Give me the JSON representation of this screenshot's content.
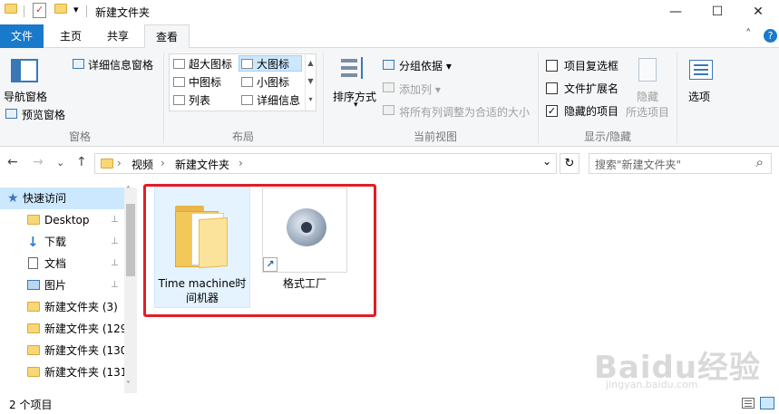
{
  "window": {
    "title": "新建文件夹",
    "quick_access_dropdown": "▾",
    "minimize": "—",
    "maximize": "☐",
    "close": "✕"
  },
  "ribbon_tabs": [
    "文件",
    "主页",
    "共享",
    "查看"
  ],
  "ribbon_collapse_glyph": "˄",
  "help_glyph": "?",
  "ribbon": {
    "panes": {
      "label": "窗格",
      "nav_pane": "导航窗格",
      "preview_pane": "预览窗格",
      "details_pane": "详细信息窗格"
    },
    "layout": {
      "label": "布局",
      "items": [
        "超大图标",
        "大图标",
        "中图标",
        "小图标",
        "列表",
        "详细信息"
      ],
      "selected": "大图标"
    },
    "current_view": {
      "label": "当前视图",
      "sort_by": "排序方式",
      "group_by": "分组依据",
      "add_column": "添加列",
      "size_columns": "将所有列调整为合适的大小"
    },
    "show_hide": {
      "label": "显示/隐藏",
      "item_checkboxes": "项目复选框",
      "file_extensions": "文件扩展名",
      "hidden_items": "隐藏的项目",
      "hide_selected_line1": "隐藏",
      "hide_selected_line2": "所选项目",
      "options": "选项"
    },
    "checkbox_states": {
      "item_checkboxes": "",
      "file_extensions": "",
      "hidden_items": "✓"
    }
  },
  "address": {
    "back": "←",
    "forward": "→",
    "recent": "⌄",
    "up": "↑",
    "segments": [
      "视频",
      "新建文件夹"
    ],
    "separator": "›",
    "dropdown": "⌄",
    "refresh": "↻"
  },
  "search": {
    "placeholder": "搜索\"新建文件夹\"",
    "icon": "⌕"
  },
  "nav_pane": {
    "items": [
      {
        "label": "快速访问",
        "icon": "star-icon",
        "pinned": false
      },
      {
        "label": "Desktop",
        "icon": "folder-icon",
        "pinned": true
      },
      {
        "label": "下载",
        "icon": "download-icon",
        "pinned": true
      },
      {
        "label": "文档",
        "icon": "document-icon",
        "pinned": true
      },
      {
        "label": "图片",
        "icon": "picture-icon",
        "pinned": true
      },
      {
        "label": "新建文件夹 (3)",
        "icon": "folder-icon",
        "pinned": false
      },
      {
        "label": "新建文件夹 (129",
        "icon": "folder-icon",
        "pinned": false
      },
      {
        "label": "新建文件夹 (130",
        "icon": "folder-icon",
        "pinned": false
      },
      {
        "label": "新建文件夹 (131",
        "icon": "folder-icon",
        "pinned": false
      }
    ],
    "pin_glyph": "📌",
    "scroll_up": "˄",
    "scroll_down": "˅"
  },
  "files": [
    {
      "name_line1": "Time machine时",
      "name_line2": "间机器",
      "type": "folder"
    },
    {
      "name_line1": "格式工厂",
      "name_line2": "",
      "type": "shortcut"
    }
  ],
  "shortcut_arrow": "↗",
  "status": {
    "item_count": "2 个项目"
  },
  "watermark": {
    "text": "Baidu经验",
    "sub": "jingyan.baidu.com"
  }
}
